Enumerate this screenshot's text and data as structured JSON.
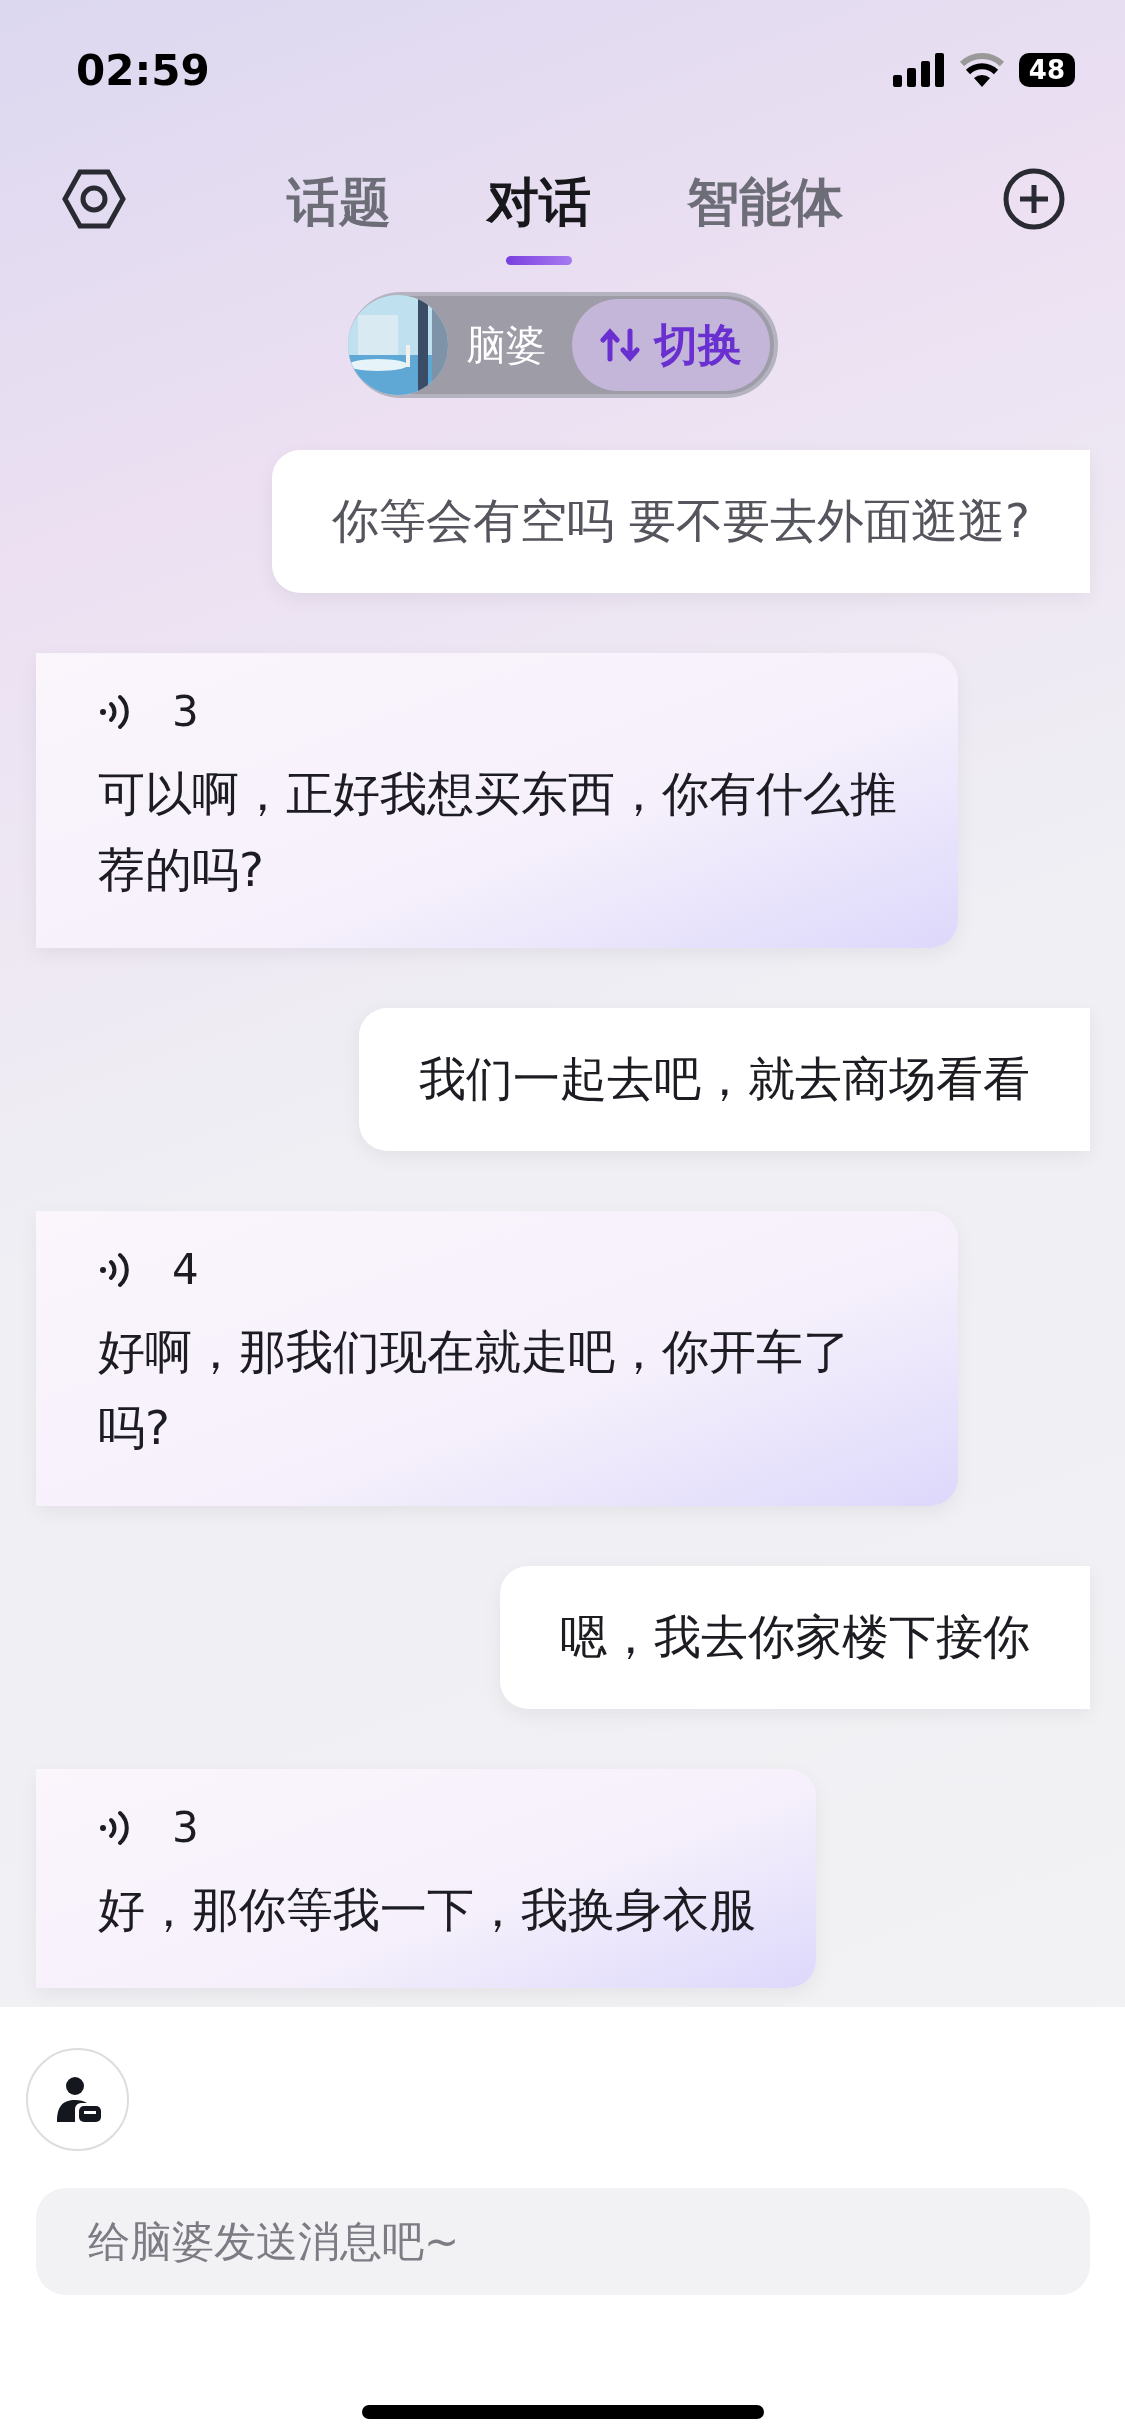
{
  "status_bar": {
    "time": "02:59",
    "battery": "48"
  },
  "tabs": [
    {
      "label": "话题",
      "selected": false
    },
    {
      "label": "对话",
      "selected": true
    },
    {
      "label": "智能体",
      "selected": false
    }
  ],
  "character": {
    "name": "脑婆",
    "switch_label": "切换"
  },
  "messages": [
    {
      "kind": "user",
      "text": "你等会有空吗 要不要去外面逛逛?"
    },
    {
      "kind": "ai",
      "duration": "3",
      "text": "可以啊，正好我想买东西，你有什么推荐的吗?"
    },
    {
      "kind": "user",
      "text": "我们一起去吧，就去商场看看"
    },
    {
      "kind": "ai",
      "duration": "4",
      "text": "好啊，那我们现在就走吧，你开车了吗?"
    },
    {
      "kind": "user",
      "text": "嗯，我去你家楼下接你"
    },
    {
      "kind": "ai",
      "duration": "3",
      "text": "好，那你等我一下，我换身衣服"
    }
  ],
  "composer": {
    "placeholder": "给脑婆发送消息吧~"
  }
}
